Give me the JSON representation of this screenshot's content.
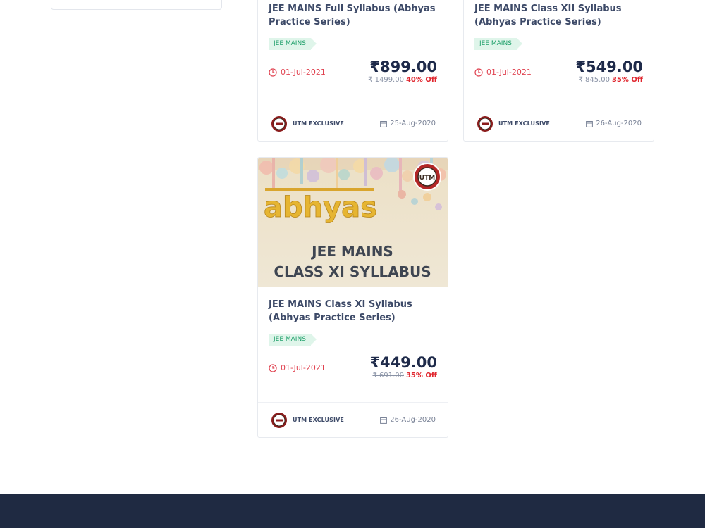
{
  "cards": [
    {
      "title": "JEE MAINS Full Syllabus (Abhyas Practice Series)",
      "tag": "JEE MAINS",
      "start_date": "01-Jul-2021",
      "price": "₹899.00",
      "old_price": "₹ 1499.00",
      "discount": "40% Off",
      "brand": "UTM EXCLUSIVE",
      "posted_date": "25-Aug-2020"
    },
    {
      "title": "JEE MAINS Class XII Syllabus (Abhyas Practice Series)",
      "tag": "JEE MAINS",
      "start_date": "01-Jul-2021",
      "price": "₹549.00",
      "old_price": "₹ 845.00",
      "discount": "35% Off",
      "brand": "UTM EXCLUSIVE",
      "posted_date": "26-Aug-2020"
    },
    {
      "title": "JEE MAINS Class XI Syllabus (Abhyas Practice Series)",
      "tag": "JEE MAINS",
      "start_date": "01-Jul-2021",
      "price": "₹449.00",
      "old_price": "₹ 691.00",
      "discount": "35% Off",
      "brand": "UTM EXCLUSIVE",
      "posted_date": "26-Aug-2020",
      "thumbnail": {
        "logo_text": "abhyas",
        "heading_line1": "JEE MAINS",
        "heading_line2": "CLASS XI SYLLABUS",
        "badge_text": "UTM"
      }
    }
  ],
  "colors": {
    "accent_red": "#e0414f",
    "tag_green": "#1fa06a",
    "footer_bg": "#1f2a42"
  }
}
